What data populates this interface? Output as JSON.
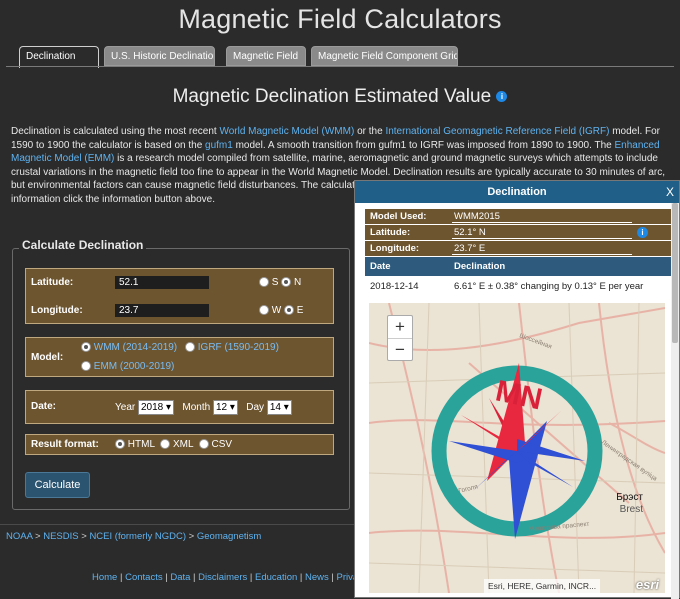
{
  "site": {
    "title": "Magnetic Field Calculators"
  },
  "tabs": [
    {
      "label": "Declination",
      "active": true
    },
    {
      "label": "U.S. Historic Declination",
      "active": false
    },
    {
      "label": "Magnetic Field",
      "active": false
    },
    {
      "label": "Magnetic Field Component Grid",
      "active": false
    }
  ],
  "heading": "Magnetic Declination Estimated Value",
  "intro": {
    "t1": "Declination is calculated using the most recent ",
    "link_wmm": "World Magnetic Model (WMM)",
    "t2": " or the ",
    "link_igrf": "International Geomagnetic Reference Field (IGRF)",
    "t3": " model. For 1590 to 1900 the calculator is based on the ",
    "link_gufm1": "gufm1",
    "t4": " model. A smooth transition from gufm1 to IGRF was imposed from 1890 to 1900. The ",
    "link_emm": "Enhanced Magnetic Model (EMM)",
    "t5": " is a research model compiled from satellite, marine, aeromagnetic and ground magnetic surveys which attempts to include crustal variations in the magnetic field too fine to appear in the World Magnetic Model. Declination results are typically accurate to 30 minutes of arc, but environmental factors can cause magnetic field disturbances. The calculator provides an easy way for you t",
    "t6": "information click the information button above."
  },
  "form": {
    "legend": "Calculate Declination",
    "latitude_label": "Latitude:",
    "latitude_value": "52.1",
    "lat_s": "S",
    "lat_n": "N",
    "longitude_label": "Longitude:",
    "longitude_value": "23.7",
    "lon_w": "W",
    "lon_e": "E",
    "model_label": "Model:",
    "model_wmm": "WMM (2014-2019)",
    "model_igrf": "IGRF (1590-2019)",
    "model_emm": "EMM (2000-2019)",
    "date_label": "Date:",
    "year_label": "Year",
    "year_value": "2018",
    "month_label": "Month",
    "month_value": "12",
    "day_label": "Day",
    "day_value": "14",
    "format_label": "Result format:",
    "fmt_html": "HTML",
    "fmt_xml": "XML",
    "fmt_csv": "CSV",
    "button": "Calculate"
  },
  "breadcrumb": {
    "noaa": "NOAA",
    "sep": " > ",
    "nesdis": "NESDIS",
    "ncei": "NCEI (formerly NGDC)",
    "geo": "Geomagnetism"
  },
  "footer": [
    "Home",
    "Contacts",
    "Data",
    "Disclaimers",
    "Education",
    "News",
    "Privacy I"
  ],
  "popup": {
    "title": "Declination",
    "close": "X",
    "model_label": "Model Used:",
    "model_value": "WMM2015",
    "lat_label": "Latitude:",
    "lat_value": "52.1° N",
    "lon_label": "Longitude:",
    "lon_value": "23.7° E",
    "col_date": "Date",
    "col_decl": "Declination",
    "row_date": "2018-12-14",
    "row_decl": "6.61° E  ± 0.38°  changing by  0.13° E per year"
  },
  "map": {
    "zoom_in": "+",
    "zoom_out": "−",
    "compass_label": "MN",
    "city_ru": "Брэст",
    "city_en": "Brest",
    "attribution": "Esri, HERE, Garmin, INCR...",
    "esri": "esri",
    "street_1": "Шоссейная",
    "street_2": "Гоголя",
    "street_3": "Машэрава праспект",
    "street_4": "Ленинградская вуліца"
  },
  "colors": {
    "accent": "#1f5f88",
    "panel": "#6d5530",
    "link": "#5fb3f0"
  }
}
